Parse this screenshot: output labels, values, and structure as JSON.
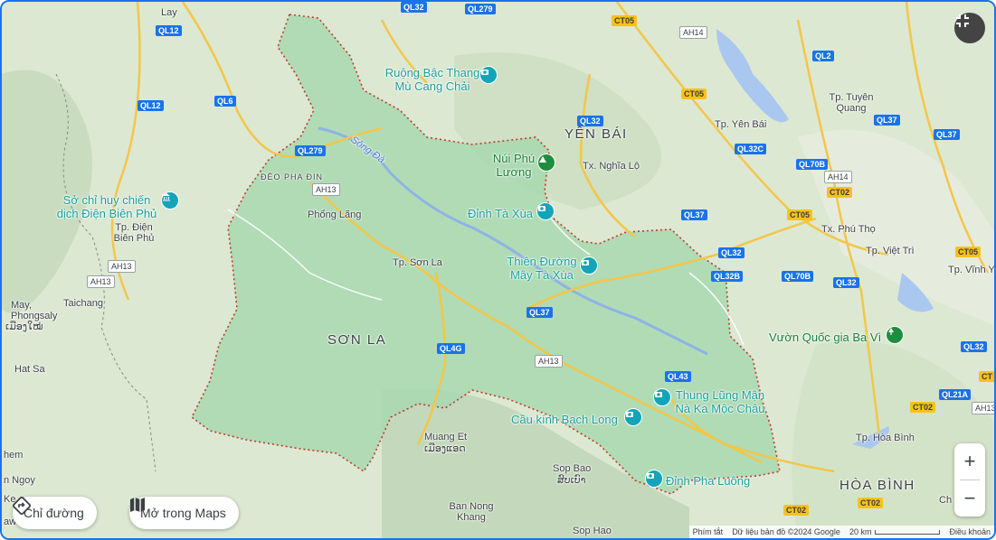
{
  "map": {
    "region_labels": [
      "SƠN LA",
      "YÊN BÁI",
      "HÒA BÌNH"
    ],
    "cities": [
      "Lay",
      "Tp. Điện Biên Phủ",
      "Taichang",
      "May, Phongsaly",
      "ເມືອງໃໝ່",
      "Hat Sa",
      "hem",
      "n Ngoy",
      "Ke",
      "aw",
      "Phổng Lãng",
      "Tp. Sơn La",
      "Tx. Nghĩa Lộ",
      "Tp. Yên Bái",
      "Tp. Tuyên Quang",
      "Tx. Phú Thọ",
      "Tp. Việt Trì",
      "Tp. Vĩnh Y",
      "Tp. Hòa Bình",
      "Ch",
      "Muang Et",
      "ເມືອງແອດ",
      "Sop Bao",
      "ສົບເບົາ",
      "Ban Nong Khang",
      "Sop Hao",
      "ĐÈO PHA ĐIN"
    ],
    "river_label": "Sông Đà",
    "pois": [
      {
        "name": "Ruộng Bậc Thang Mù Cang Chải",
        "type": "camera"
      },
      {
        "name": "Núi Phú Lương",
        "type": "mountain"
      },
      {
        "name": "Đỉnh Tà Xùa",
        "type": "camera"
      },
      {
        "name": "Thiên Đường Mây Tà Xùa",
        "type": "camera"
      },
      {
        "name": "Sở chỉ huy chiến dịch Điện Biên Phủ",
        "type": "museum"
      },
      {
        "name": "Thung Lũng Mận Nà Ka Mộc Châu",
        "type": "camera"
      },
      {
        "name": "Cầu kính Bạch Long",
        "type": "camera"
      },
      {
        "name": "Đỉnh Pha Luông",
        "type": "camera"
      },
      {
        "name": "Vườn Quốc gia Ba Vì",
        "type": "park"
      }
    ],
    "road_shields": [
      "QL12",
      "QL279",
      "QL6",
      "QL12",
      "QL279",
      "AH13",
      "AH13",
      "AH13",
      "QL4G",
      "QL37",
      "AH13",
      "QL43",
      "QL32",
      "QL37",
      "QL32",
      "QL32B",
      "CT05",
      "AH14",
      "CT05",
      "QL2",
      "QL32C",
      "QL70B",
      "AH14",
      "CT02",
      "CT05",
      "QL32",
      "QL70B",
      "QL37",
      "QL37",
      "CT05",
      "QL32",
      "QL21A",
      "AH13",
      "CT02",
      "CT02",
      "CT02",
      "QL32",
      "CT"
    ]
  },
  "controls": {
    "directions_label": "Chỉ đường",
    "open_maps_label": "Mở trong Maps",
    "zoom_in": "+",
    "zoom_out": "−"
  },
  "footer": {
    "shortcuts": "Phím tắt",
    "map_data": "Dữ liệu bản đồ ©2024 Google",
    "scale": "20 km",
    "terms": "Điều khoản"
  },
  "colors": {
    "highlight_fill": "#a8d8b0",
    "border": "#c0392b",
    "water": "#aac7ef",
    "poi_teal": "#13a4b9",
    "poi_green": "#1e8e3e",
    "frame": "#1a73e8"
  }
}
